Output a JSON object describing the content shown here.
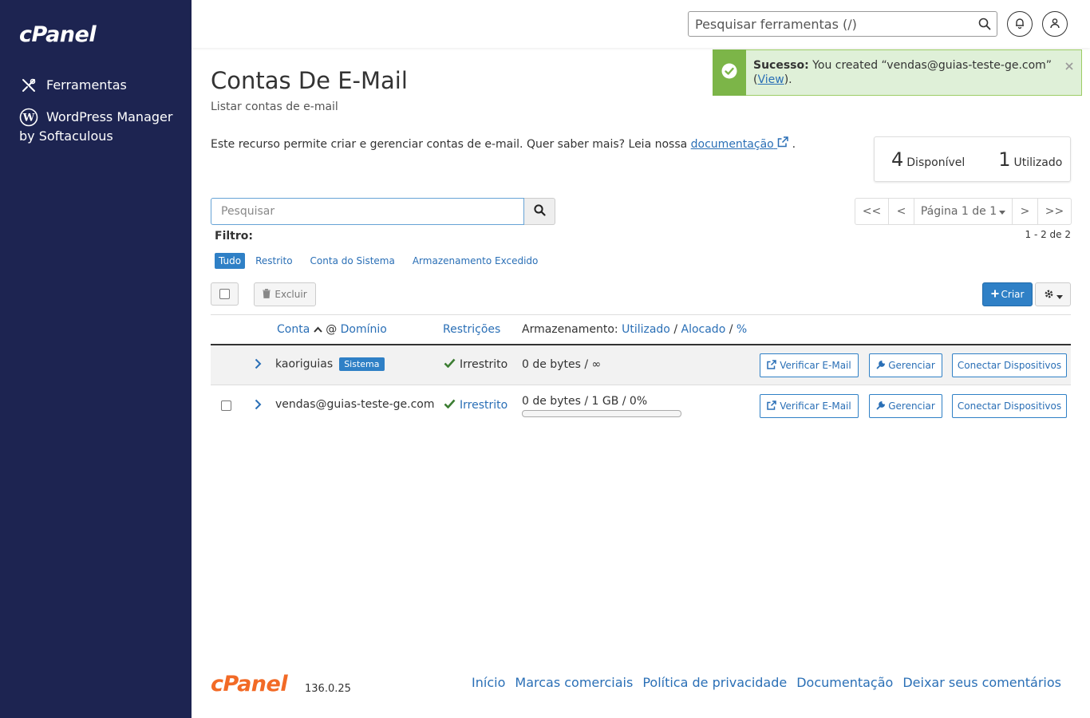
{
  "sidebar": {
    "logo": "cPanel",
    "items": [
      {
        "label": "Ferramentas"
      },
      {
        "label": "WordPress Manager by Softaculous"
      }
    ]
  },
  "header": {
    "search_placeholder": "Pesquisar ferramentas (/)"
  },
  "alert": {
    "strong": "Sucesso:",
    "text": " You created “vendas@guias-teste-ge.com” ",
    "link_open": "(",
    "link": "View",
    "link_close": ")."
  },
  "page": {
    "title": "Contas De E-Mail",
    "subtitle": "Listar contas de e-mail",
    "intro_text": "Este recurso permite criar e gerenciar contas de e-mail. Quer saber mais? Leia nossa ",
    "intro_link": "documentação",
    "intro_end": " ."
  },
  "stats": {
    "available_num": "4",
    "available_label": "Disponível",
    "used_num": "1",
    "used_label": "Utilizado"
  },
  "search": {
    "placeholder": "Pesquisar"
  },
  "pager": {
    "first": "<<",
    "prev": "<",
    "page": "Página 1 de 1",
    "next": ">",
    "last": ">>",
    "range": "1 - 2 de 2"
  },
  "filters": {
    "label": "Filtro:",
    "items": [
      "Tudo",
      "Restrito",
      "Conta do Sistema",
      "Armazenamento Excedido"
    ]
  },
  "actions": {
    "delete": "Excluir",
    "create": "Criar"
  },
  "table": {
    "col_account": "Conta",
    "col_at": "@",
    "col_domain": "Domínio",
    "col_restrictions": "Restrições",
    "col_storage": "Armazenamento:",
    "col_used": "Utilizado",
    "col_sep": "/",
    "col_allocated": "Alocado",
    "col_pct": "%",
    "rows": [
      {
        "account": "kaoriguias",
        "badge": "Sistema",
        "restriction": "Irrestrito",
        "storage": "0 de bytes / ∞",
        "btn_check": "Verificar E-Mail",
        "btn_manage": "Gerenciar",
        "btn_connect": "Conectar Dispositivos"
      },
      {
        "account": "vendas@guias-teste-ge.com",
        "restriction": "Irrestrito",
        "storage": "0 de bytes / 1 GB / 0%",
        "usage_fraction": 0,
        "btn_check": "Verificar E-Mail",
        "btn_manage": "Gerenciar",
        "btn_connect": "Conectar Dispositivos"
      }
    ]
  },
  "footer": {
    "logo": "cPanel",
    "version": "136.0.25",
    "links": [
      "Início",
      "Marcas comerciais",
      "Política de privacidade",
      "Documentação",
      "Deixar seus comentários"
    ]
  },
  "colors": {
    "sidebar": "#1d2451",
    "accent": "#2f80c6",
    "success": "#7cb548",
    "footer_logo": "#f26a26"
  }
}
